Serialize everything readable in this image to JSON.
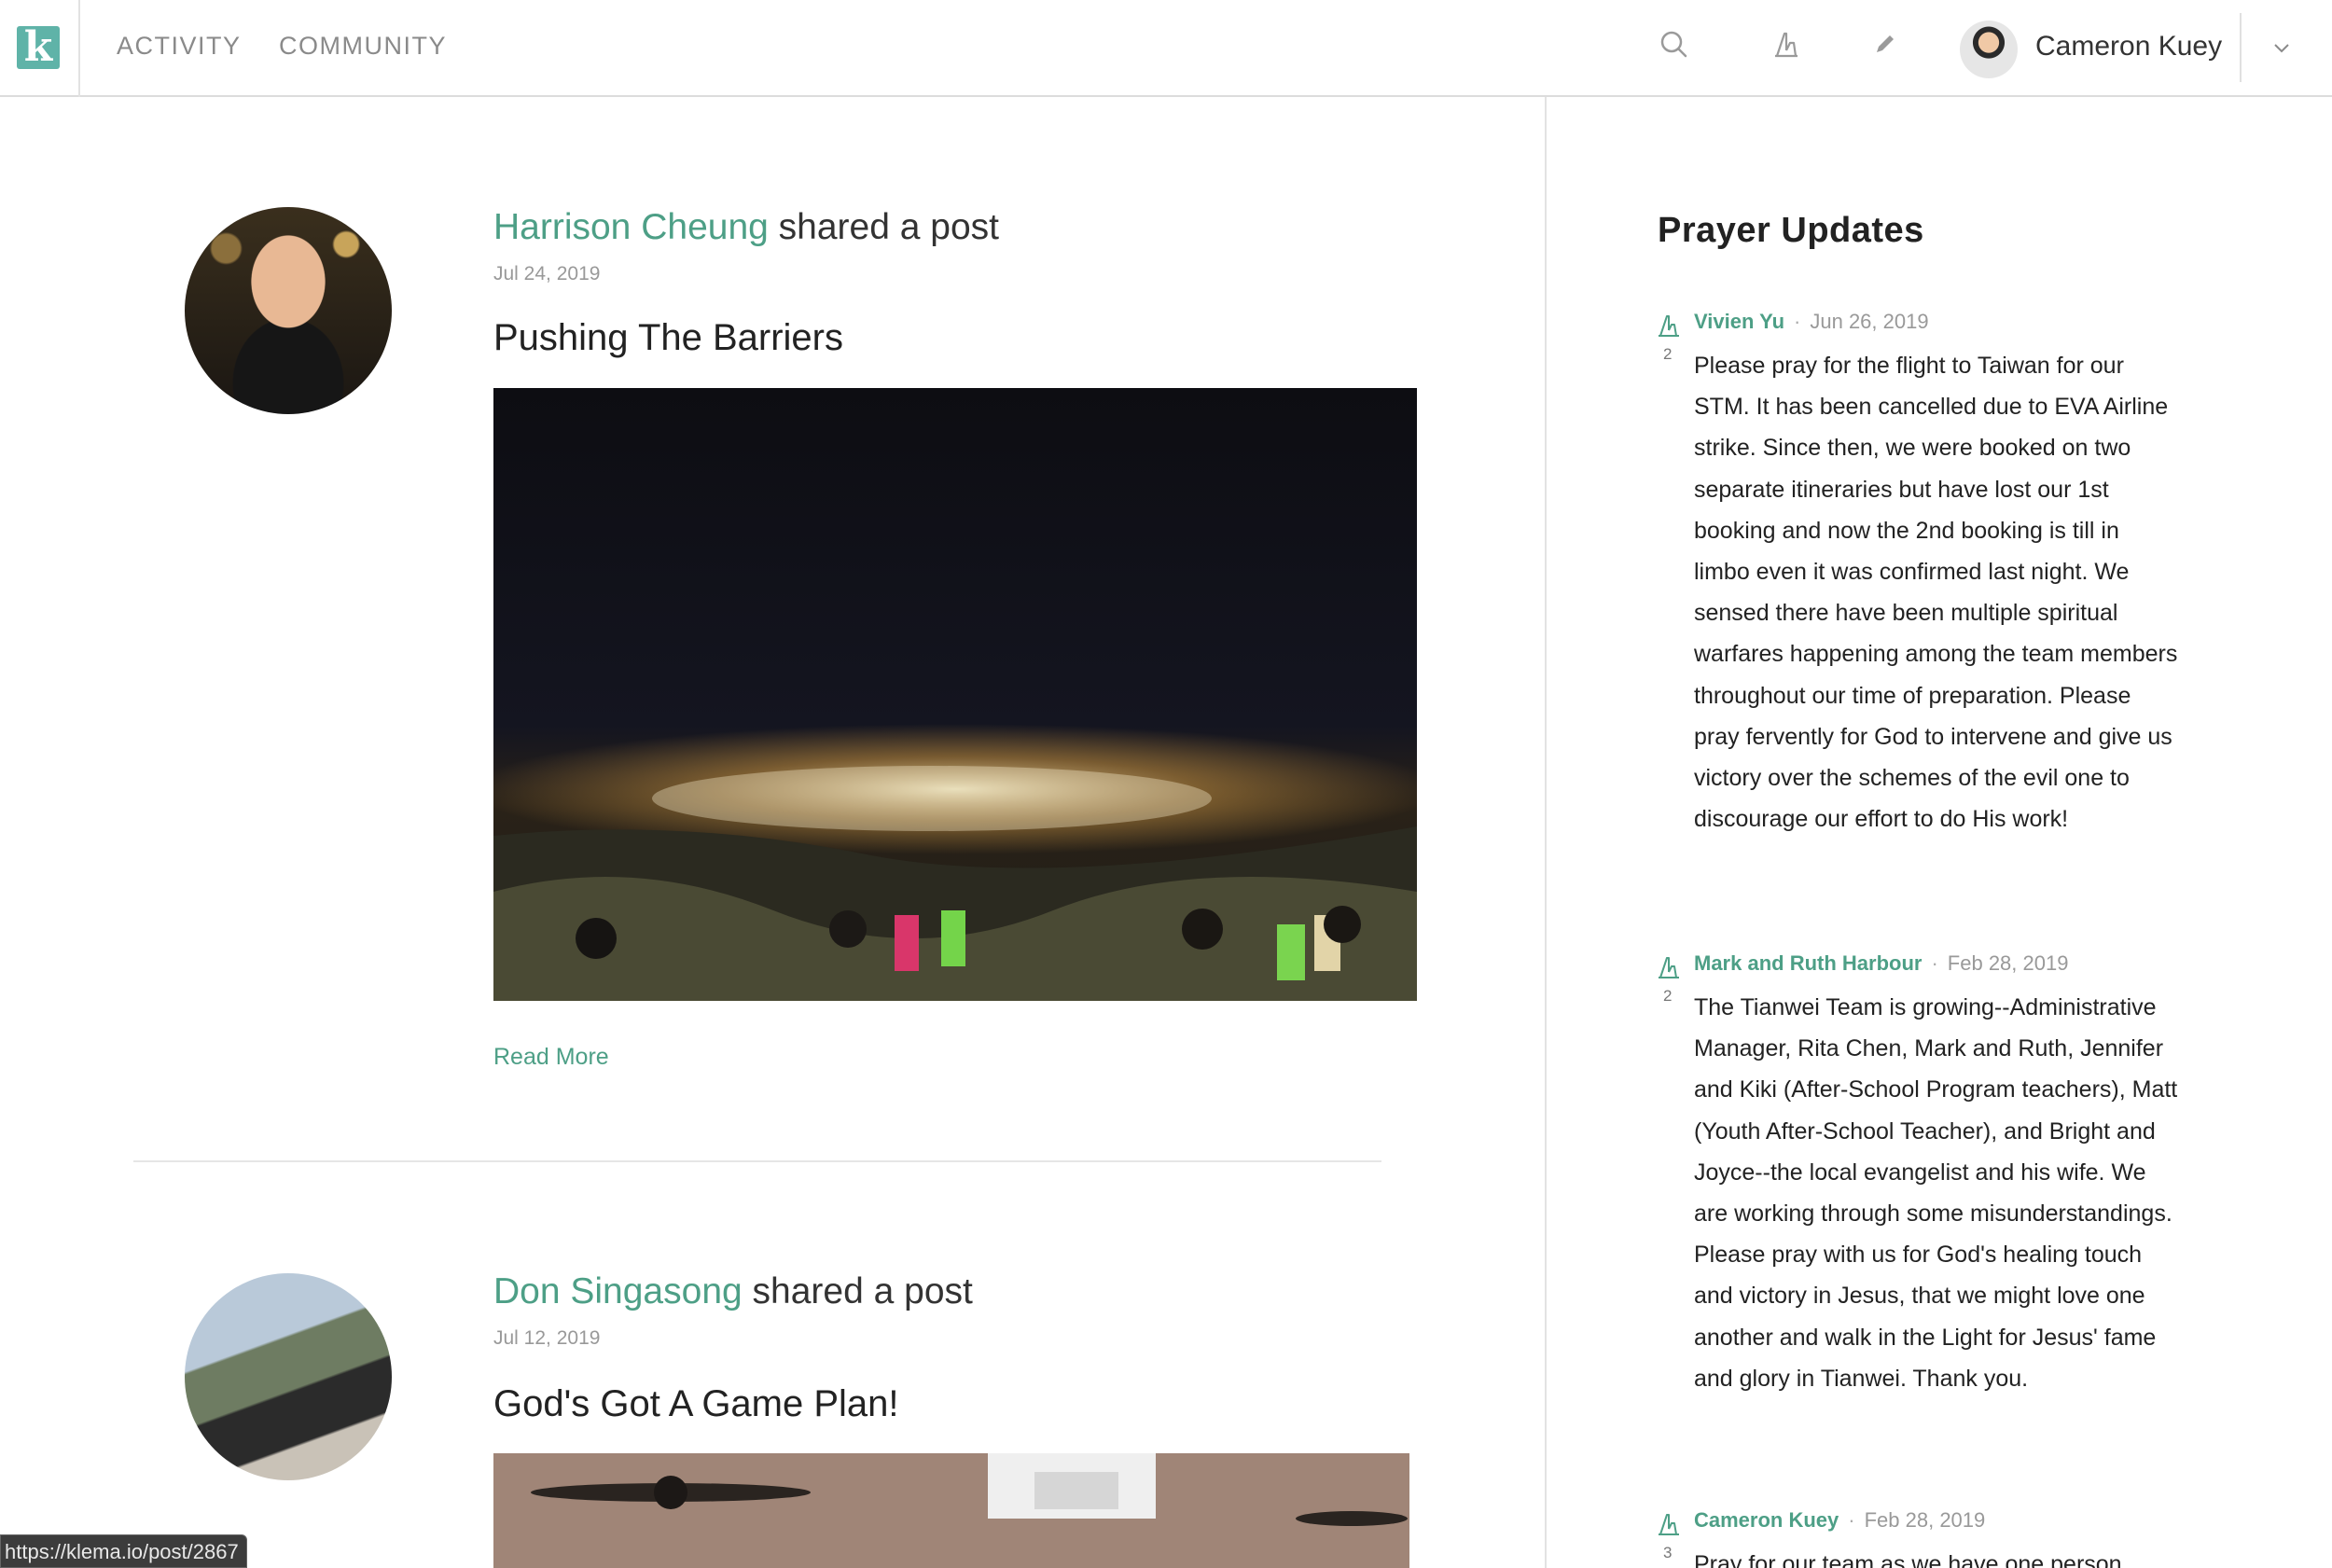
{
  "nav": {
    "logo_letter": "k",
    "links": [
      "ACTIVITY",
      "COMMUNITY"
    ]
  },
  "toolbar": {
    "icons": [
      "search-icon",
      "pray-icon",
      "pencil-icon"
    ]
  },
  "user": {
    "name": "Cameron Kuey"
  },
  "colors": {
    "accent": "#4d9f86",
    "logo": "#5fb3a8"
  },
  "posts": [
    {
      "author": "Harrison Cheung",
      "action": "shared a post",
      "date": "Jul 24, 2019",
      "title": "Pushing The Barriers",
      "read_more": "Read More"
    },
    {
      "author": "Don Singasong",
      "action": "shared a post",
      "date": "Jul 12, 2019",
      "title": "God's Got A Game Plan!"
    }
  ],
  "sidebar": {
    "title": "Prayer Updates",
    "updates": [
      {
        "author": "Vivien Yu",
        "date": "Jun 26, 2019",
        "count": "2",
        "text": "Please pray for the flight to Taiwan for our STM. It has been cancelled due to EVA Airline strike. Since then, we were booked on two separate itineraries but have lost our 1st booking and now the 2nd booking is till in limbo even it was confirmed last night. We sensed there have been multiple spiritual warfares happening among the team members throughout our time of preparation. Please pray fervently for God to intervene and give us victory over the schemes of the evil one to discourage our effort to do His work!"
      },
      {
        "author": "Mark and Ruth Harbour",
        "date": "Feb 28, 2019",
        "count": "2",
        "text": "The Tianwei Team is growing--Administrative Manager, Rita Chen, Mark and Ruth, Jennifer and Kiki (After-School Program teachers), Matt (Youth After-School Teacher), and Bright and Joyce--the local evangelist and his wife. We are working through some misunderstandings. Please pray with us for God's healing touch and victory in Jesus, that we might love one another and walk in the Light for Jesus' fame and glory in Tianwei. Thank you."
      },
      {
        "author": "Cameron Kuey",
        "date": "Feb 28, 2019",
        "count": "3",
        "text": "Pray for our team as we have one person"
      }
    ]
  },
  "status_bar": {
    "url": "https://klema.io/post/2867"
  }
}
